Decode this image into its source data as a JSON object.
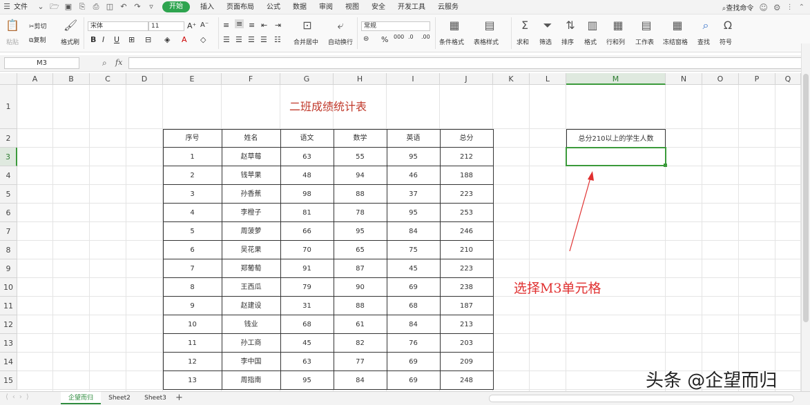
{
  "menubar": {
    "file_label": "文件",
    "tabs": [
      "开始",
      "插入",
      "页面布局",
      "公式",
      "数据",
      "审阅",
      "视图",
      "安全",
      "开发工具",
      "云服务"
    ],
    "search_label": "查找命令"
  },
  "ribbon": {
    "paste": "粘贴",
    "cut": "剪切",
    "copy": "复制",
    "format_painter": "格式刷",
    "font_name": "宋体",
    "font_size": "11",
    "merge_center": "合并居中",
    "wrap_text": "自动换行",
    "number_format": "常规",
    "conditional_format": "条件格式",
    "table_style": "表格样式",
    "sum": "求和",
    "filter": "筛选",
    "sort": "排序",
    "format": "格式",
    "row_col": "行和列",
    "worksheet": "工作表",
    "freeze": "冻结窗格",
    "find": "查找",
    "symbol": "符号"
  },
  "formula": {
    "cell_ref": "M3",
    "fx_label": "fx",
    "value": ""
  },
  "grid": {
    "columns": [
      "A",
      "B",
      "C",
      "D",
      "E",
      "F",
      "G",
      "H",
      "I",
      "J",
      "K",
      "L",
      "M",
      "N",
      "O",
      "P",
      "Q"
    ],
    "rows": [
      "1",
      "2",
      "3",
      "4",
      "5",
      "6",
      "7",
      "8",
      "9",
      "10",
      "11",
      "12",
      "13",
      "14",
      "15"
    ],
    "title": "二班成绩统计表",
    "table_headers": [
      "序号",
      "姓名",
      "语文",
      "数学",
      "英语",
      "总分"
    ],
    "table_rows": [
      [
        "1",
        "赵草莓",
        "63",
        "55",
        "95",
        "212"
      ],
      [
        "2",
        "钱苹果",
        "48",
        "94",
        "46",
        "188"
      ],
      [
        "3",
        "孙香蕉",
        "98",
        "88",
        "37",
        "223"
      ],
      [
        "4",
        "李橙子",
        "81",
        "78",
        "95",
        "253"
      ],
      [
        "5",
        "周菠萝",
        "66",
        "95",
        "84",
        "246"
      ],
      [
        "6",
        "吴花果",
        "70",
        "65",
        "75",
        "210"
      ],
      [
        "7",
        "郑葡萄",
        "91",
        "87",
        "45",
        "223"
      ],
      [
        "8",
        "王西瓜",
        "79",
        "90",
        "69",
        "238"
      ],
      [
        "9",
        "赵建设",
        "31",
        "88",
        "68",
        "187"
      ],
      [
        "10",
        "钱业",
        "68",
        "61",
        "84",
        "213"
      ],
      [
        "11",
        "孙工商",
        "45",
        "82",
        "76",
        "203"
      ],
      [
        "12",
        "李中国",
        "63",
        "77",
        "69",
        "209"
      ],
      [
        "13",
        "周指南",
        "95",
        "84",
        "69",
        "248"
      ]
    ],
    "m2_label": "总分210以上的学生人数",
    "annotation": "选择M3单元格"
  },
  "sheets": [
    "企望而归",
    "Sheet2",
    "Sheet3"
  ],
  "watermark": "头条 @企望而归",
  "colors": {
    "accent_green": "#2ea44f",
    "title_red": "#c0392b",
    "annotation_red": "#e03030",
    "selection_green": "#3a9a3a"
  }
}
